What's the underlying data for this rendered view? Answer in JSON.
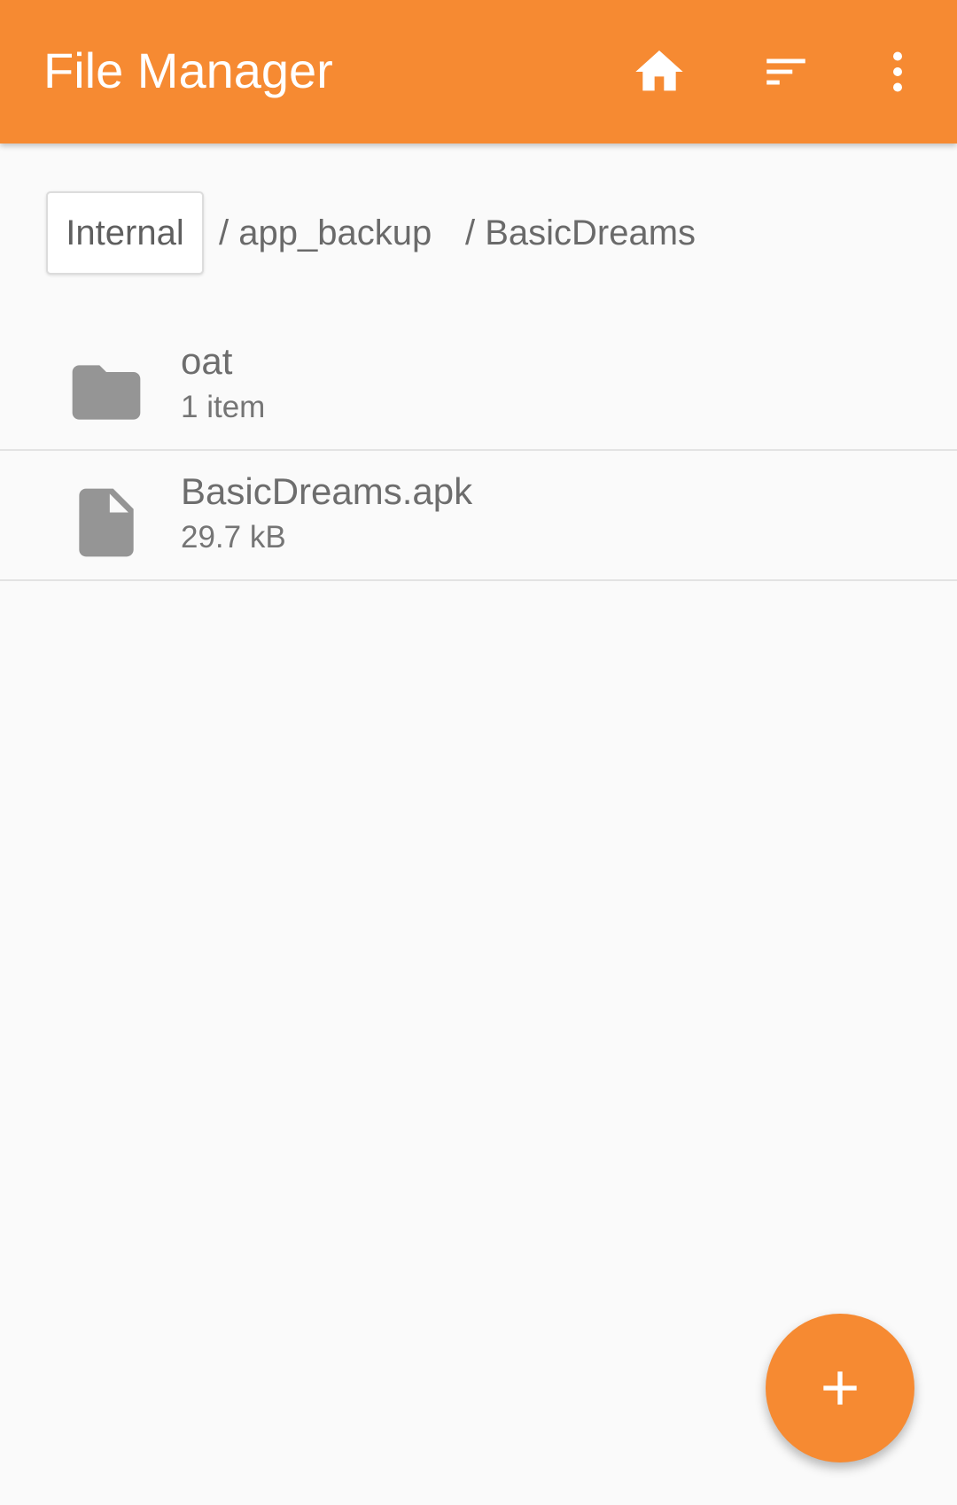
{
  "app": {
    "title": "File Manager",
    "accent_color": "#f68a32",
    "actions": [
      {
        "name": "home",
        "icon": "home-icon"
      },
      {
        "name": "sort",
        "icon": "sort-icon"
      },
      {
        "name": "more-options",
        "icon": "more-vert-icon"
      }
    ]
  },
  "breadcrumb": {
    "root": "Internal",
    "segments": [
      "/ app_backup",
      "/ BasicDreams"
    ]
  },
  "files": [
    {
      "name": "oat",
      "meta": "1 item",
      "icon": "folder-icon"
    },
    {
      "name": "BasicDreams.apk",
      "meta": "29.7 kB",
      "icon": "file-icon"
    }
  ],
  "fab": {
    "icon": "add-icon"
  }
}
